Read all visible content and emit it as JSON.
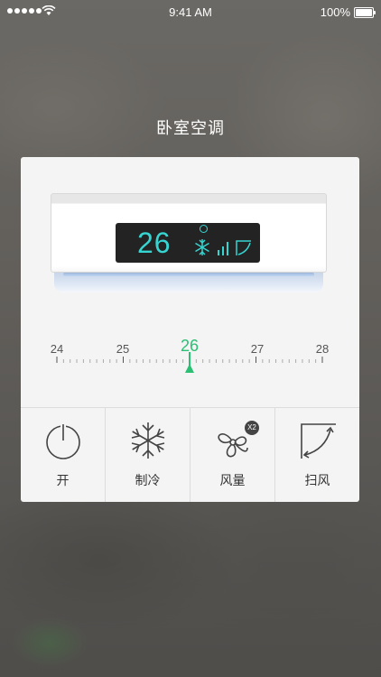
{
  "status_bar": {
    "time": "9:41 AM",
    "battery": "100%"
  },
  "header": {
    "title": "卧室空调"
  },
  "ac_unit": {
    "display_temp": "26",
    "mode_icon": "snowflake-icon",
    "fan_icon": "fan-level-icon",
    "swing_icon": "swing-icon"
  },
  "temperature_slider": {
    "labels": [
      "24",
      "25",
      "26",
      "27",
      "28"
    ],
    "selected": "26",
    "accent_color": "#2bbf74"
  },
  "controls": [
    {
      "label": "开",
      "icon": "power-icon"
    },
    {
      "label": "制冷",
      "icon": "snowflake-icon"
    },
    {
      "label": "风量",
      "icon": "fan-icon",
      "badge": "X2"
    },
    {
      "label": "扫风",
      "icon": "swing-icon"
    }
  ],
  "colors": {
    "display_text": "#36d5d2",
    "accent": "#2bbf74"
  }
}
